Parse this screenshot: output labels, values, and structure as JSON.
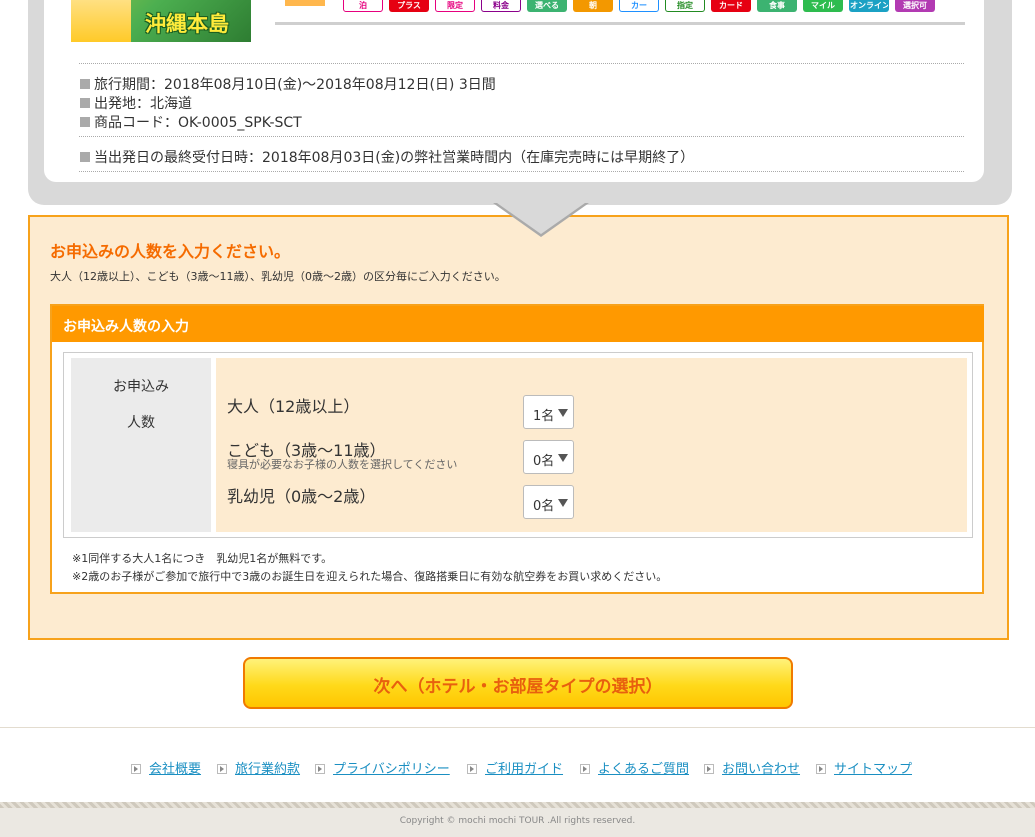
{
  "tour": {
    "thumbnail_label": "沖縄本島",
    "badges": [
      {
        "label": "泊",
        "color": "#e6007e",
        "bg": "#ffffff"
      },
      {
        "label": "プラス",
        "color": "#ffffff",
        "bg": "#e60012"
      },
      {
        "label": "限定",
        "color": "#e6007e",
        "bg": "#ffffff"
      },
      {
        "label": "料金",
        "color": "#8b008b",
        "bg": "#ffffff"
      },
      {
        "label": "選べる",
        "color": "#ffffff",
        "bg": "#3cb371"
      },
      {
        "label": "朝",
        "color": "#ffffff",
        "bg": "#f39800"
      },
      {
        "label": "カー",
        "color": "#1e90ff",
        "bg": "#ffffff"
      },
      {
        "label": "指定",
        "color": "#228b22",
        "bg": "#ffffff"
      },
      {
        "label": "カード",
        "color": "#ffffff",
        "bg": "#e60012"
      },
      {
        "label": "食事",
        "color": "#ffffff",
        "bg": "#3cb371"
      },
      {
        "label": "マイル",
        "color": "#ffffff",
        "bg": "#2ebc4f"
      },
      {
        "label": "オンライン",
        "color": "#ffffff",
        "bg": "#1ba1c4"
      },
      {
        "label": "選択可",
        "color": "#ffffff",
        "bg": "#b23ab2"
      }
    ],
    "info": {
      "travel_period": "旅行期間：2018年08月10日(金)～2018年08月12日(日) 3日間",
      "departure": "出発地：北海道",
      "product_code": "商品コード：OK-0005_SPK-SCT",
      "deadline": "当出発日の最終受付日時：2018年08月03日(金)の弊社営業時間内（在庫完売時には早期終了）"
    }
  },
  "form": {
    "title": "お申込みの人数を入力ください。",
    "description": "大人（12歳以上）、こども（3歳〜11歳）、乳幼児（0歳〜2歳）の区分毎にご入力ください。",
    "box_header": "お申込み人数の入力",
    "label_line1": "お申込み",
    "label_line2": "人数",
    "rows": [
      {
        "label": "大人（12歳以上）",
        "sub": "",
        "value": "1名"
      },
      {
        "label": "こども（3歳〜11歳）",
        "sub": "寝具が必要なお子様の人数を選択してください",
        "value": "0名"
      },
      {
        "label": "乳幼児（0歳〜2歳）",
        "sub": "",
        "value": "0名"
      }
    ],
    "notes": [
      "※1同伴する大人1名につき　乳幼児1名が無料です。",
      "※2歳のお子様がご参加で旅行中で3歳のお誕生日を迎えられた場合、復路搭乗日に有効な航空券をお買い求めください。"
    ]
  },
  "next_button": "次へ（ホテル・お部屋タイプの選択）",
  "footer": {
    "links": [
      "会社概要",
      "旅行業約款",
      "プライバシポリシー",
      "ご利用ガイド",
      "よくあるご質問",
      "お問い合わせ",
      "サイトマップ"
    ],
    "copyright": "Copyright © mochi mochi TOUR .All rights reserved."
  }
}
